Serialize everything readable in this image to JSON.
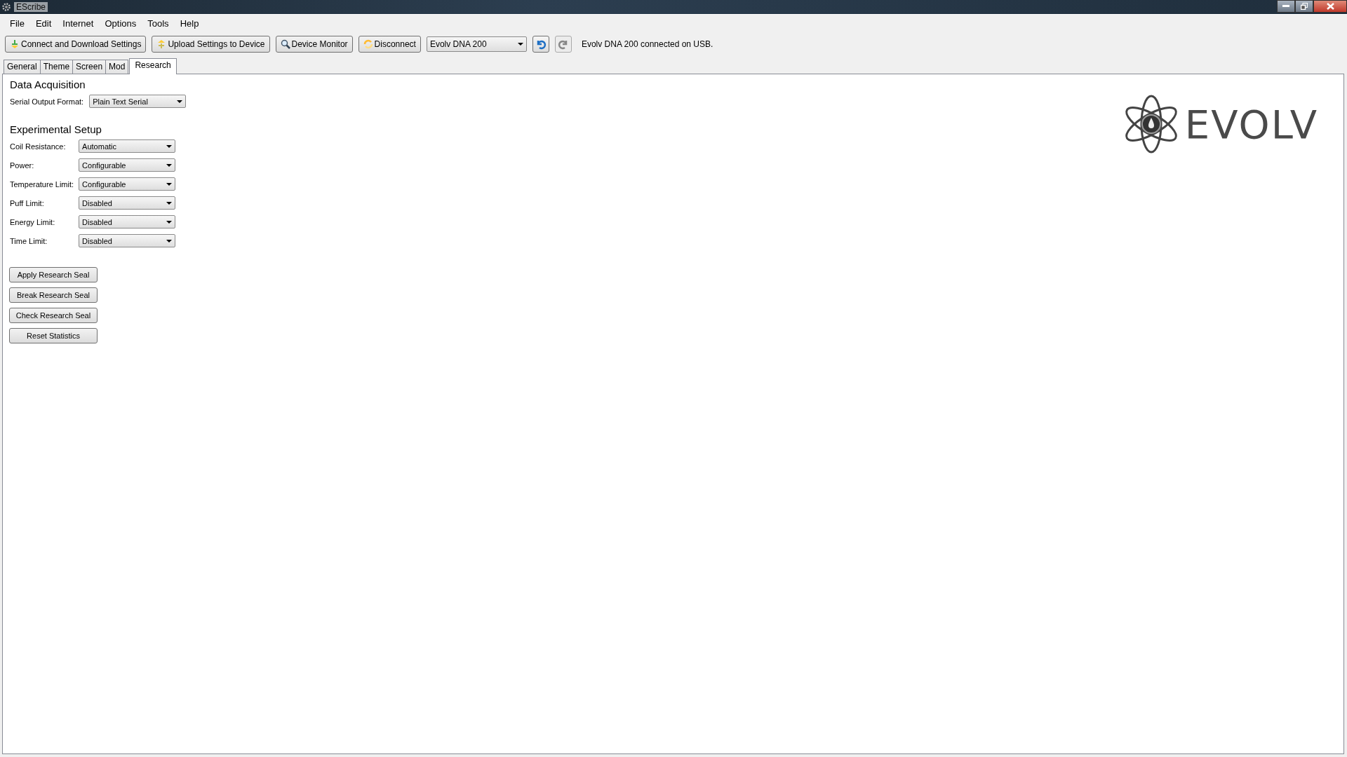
{
  "window": {
    "title": "EScribe"
  },
  "menu": [
    "File",
    "Edit",
    "Internet",
    "Options",
    "Tools",
    "Help"
  ],
  "toolbar": {
    "buttons": [
      {
        "label": "Connect and Download Settings",
        "kind": "download"
      },
      {
        "label": "Upload Settings to Device",
        "kind": "upload"
      },
      {
        "label": "Device Monitor",
        "kind": "monitor"
      },
      {
        "label": "Disconnect",
        "kind": "disconnect"
      }
    ],
    "device_select": {
      "value": "Evolv DNA 200"
    },
    "undo": {
      "disabled": false
    },
    "redo": {
      "disabled": true
    },
    "status": "Evolv DNA 200 connected on USB."
  },
  "tabs": [
    {
      "label": "General",
      "selected": false
    },
    {
      "label": "Theme",
      "selected": false
    },
    {
      "label": "Screen",
      "selected": false
    },
    {
      "label": "Mod",
      "selected": false
    },
    {
      "label": "Research",
      "selected": true
    }
  ],
  "sections": [
    {
      "title": "Data Acquisition",
      "fields": [
        {
          "label": "Serial Output Format:",
          "value": "Plain Text Serial"
        }
      ]
    },
    {
      "title": "Experimental Setup",
      "fields": [
        {
          "label": "Coil Resistance:",
          "value": "Automatic"
        },
        {
          "label": "Power:",
          "value": "Configurable"
        },
        {
          "label": "Temperature Limit:",
          "value": "Configurable"
        },
        {
          "label": "Puff Limit:",
          "value": "Disabled"
        },
        {
          "label": "Energy Limit:",
          "value": "Disabled"
        },
        {
          "label": "Time Limit:",
          "value": "Disabled"
        }
      ]
    }
  ],
  "actions": [
    "Apply Research Seal",
    "Break Research Seal",
    "Check Research Seal",
    "Reset Statistics"
  ],
  "logo": {
    "text": "EVOLV"
  }
}
